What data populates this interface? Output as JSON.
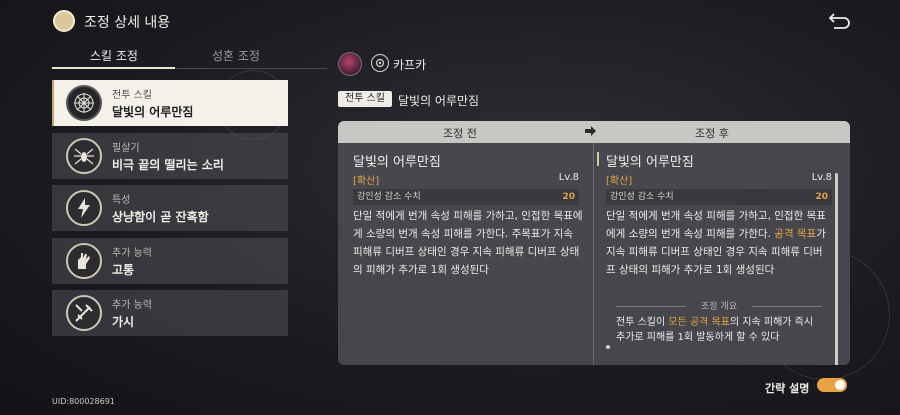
{
  "header": {
    "title": "조정 상세 내용",
    "back_icon": "back-arrow-icon"
  },
  "tabs": [
    {
      "label": "스킬 조정",
      "active": true
    },
    {
      "label": "성혼 조정",
      "active": false
    }
  ],
  "skills": [
    {
      "type": "전투 스킬",
      "name": "달빛의 어루만짐",
      "active": true,
      "icon": "web-icon"
    },
    {
      "type": "필살기",
      "name": "비극 끝의 떨리는 소리",
      "active": false,
      "icon": "spider-icon"
    },
    {
      "type": "특성",
      "name": "상냥함이 곧 잔혹함",
      "active": false,
      "icon": "lightning-icon"
    },
    {
      "type": "추가 능력",
      "name": "고통",
      "active": false,
      "icon": "hand-icon"
    },
    {
      "type": "추가 능력",
      "name": "가시",
      "active": false,
      "icon": "sword-icon"
    }
  ],
  "uid": "UID:800028691",
  "character": {
    "name": "카프카",
    "path_icon": "nihility-path-icon"
  },
  "selected_skill": {
    "tag": "전투 스킬",
    "name": "달빛의 어루만짐"
  },
  "compare": {
    "before_label": "조정 전",
    "after_label": "조정 후",
    "before": {
      "title": "달빛의 어루만짐",
      "tag": "[확산]",
      "level": "Lv.8",
      "stat_label": "강인성 감소 수치",
      "stat_value": "20",
      "desc": "단일 적에게 번개 속성 피해를 가하고, 인접한 목표에게 소량의 번개 속성 피해를 가한다. 주목표가 지속 피해류 디버프 상태인 경우 지속 피해류 디버프 상태의 피해가 추가로 1회 생성된다"
    },
    "after": {
      "title": "달빛의 어루만짐",
      "tag": "[확산]",
      "level": "Lv.8",
      "stat_label": "강인성 감소 수치",
      "stat_value": "20",
      "desc_pre": "단일 적에게 번개 속성 피해를 가하고, 인접한 목표에게 소량의 번개 속성 피해를 가한다.",
      "desc_hl": "공격 목표",
      "desc_post": "가 지속 피해류 디버프 상태인 경우 지속 피해류 디버프 상태의 피해가 추가로 1회 생성된다",
      "summary_label": "조정 개요",
      "summary_pre": "전투 스킬이 ",
      "summary_hl": "모든 공격 목표",
      "summary_post": "의 지속 피해가 즉시 추가로 피해를 1회 발동하게 할 수 있다"
    }
  },
  "brief_toggle": {
    "label": "간략 설명",
    "on": true
  },
  "colors": {
    "accent": "#e9a341",
    "panel_bg": "#4a4b50",
    "active_item_bg": "#f4f1ea"
  }
}
